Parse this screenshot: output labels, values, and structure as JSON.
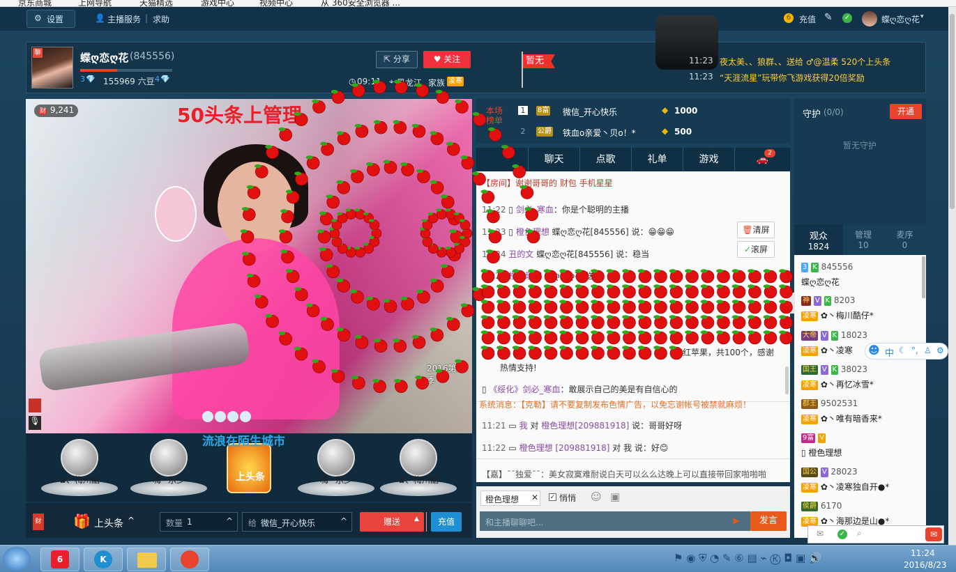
{
  "bookmarks": [
    "京东商城",
    "上网导航",
    "天猫精选",
    "游戏中心",
    "视频中心",
    "从 360安全浏览器 ..."
  ],
  "topnav": {
    "settings": "设置",
    "anchor_service": "主播服务",
    "help": "求助",
    "recharge": "充值",
    "username": "蝶ღ恋ღ花"
  },
  "anchor": {
    "name": "蝶ღ恋ღ花",
    "id": "(845556)",
    "level_left": "3",
    "beans": "155969 六豆",
    "level_right": "4",
    "share": "分享",
    "follow": "关注",
    "time": "09:11",
    "location": "黑龙江",
    "family_label": "家族",
    "family_badge": "凌寒",
    "flag": "暂无"
  },
  "notices": [
    {
      "time": "11:23",
      "text": "夜太美、、狼群、、送给 ♂@温柔 520个上头条"
    },
    {
      "time": "11:23",
      "text": "“天涯流星”玩带你飞游戏获得20倍奖励"
    }
  ],
  "video": {
    "count": "9,241",
    "overlay": "50头条上管理",
    "scroll_text": "流浪在陌生城市",
    "brand": "2016第二季"
  },
  "contributors": [
    {
      "name": "✿、梅川酷"
    },
    {
      "name": "嗨~乐少"
    },
    {
      "name": "上头条"
    },
    {
      "name": "嗨~乐少"
    },
    {
      "name": "✿、梅川酷"
    }
  ],
  "giftbar": {
    "headline": "上头条",
    "qty_label": "数量",
    "qty": "1",
    "to_label": "给",
    "to_name": "微信_开心快乐",
    "give": "赠送",
    "recharge": "充值"
  },
  "rank": {
    "title_line1": "本场",
    "title_line2": "榜单",
    "rows": [
      {
        "rank": "1",
        "badge": "8富",
        "name": "微信_开心快乐",
        "amount": "1000"
      },
      {
        "rank": "2",
        "badge": "公爵",
        "name": "铁血o亲爱丶贝o！*",
        "amount": "500"
      }
    ]
  },
  "chat_tabs": [
    "聊天",
    "点歌",
    "礼单",
    "游戏"
  ],
  "car_count": "2",
  "chat": {
    "room_line": "【房间】谢谢哥哥的 财包 手机星星",
    "lines": [
      {
        "time": "11:22",
        "nick": "剑必_寒血",
        "text": "：你是个聪明的主播"
      },
      {
        "time": "11:23",
        "nick": "橙色理想",
        "text": "蝶ღ恋ღ花[845556] 说：😁😁😁"
      },
      {
        "time": "11:24",
        "nick": "丑的文",
        "text": "蝶ღ恋ღ花[845556] 说：稳当"
      },
      {
        "time": "11:24",
        "nick": "橙色理想",
        "text": "蝶ღ恋ღ花 送"
      }
    ],
    "gift_tail": "红苹果，共100个，感谢",
    "gift_tail2": "热情支持!",
    "line_after": {
      "nick": "《绥化》剑必_寒血",
      "text": "：敢展示自己的美是有自信心的"
    },
    "system_line": "系统消息：【克勒】请不要复制发布色情广告，以免忘谢帐号被禁就麻烦！",
    "private": [
      {
        "time": "11:21",
        "me": "我",
        "to": "对",
        "nick": "橙色理想[209881918]",
        "text": "说：哥哥好呀"
      },
      {
        "time": "11:22",
        "me": "",
        "to": "",
        "nick": "橙色理想 [209881918]",
        "text": "对 我 说：好😊"
      }
    ],
    "broadcast": "【嘉】ˉˉ独爱ˉˉ：美女寂寞难耐说白天可以么么达晚上可以直接带回家啪啪啪",
    "clear": "清屏",
    "scroll": "滚屏"
  },
  "input": {
    "target": "橙色理想",
    "whisper": "悄悄",
    "placeholder": "和主播聊聊吧...",
    "send": "发言"
  },
  "guard": {
    "title": "守护",
    "count": "(0/0)",
    "open": "开通",
    "empty": "暂无守护"
  },
  "audience_tabs": [
    {
      "label": "观众",
      "count": "1824"
    },
    {
      "label": "管理",
      "count": "10"
    },
    {
      "label": "麦序",
      "count": "0"
    }
  ],
  "audience": [
    {
      "badge": "",
      "id": "845556",
      "name": "蝶ღ恋ღ花"
    },
    {
      "badge": "神",
      "id": "8203",
      "name": "✿丶梅川酷仔*"
    },
    {
      "badge": "大帝",
      "id": "18023",
      "name": "✿丶凌寒"
    },
    {
      "badge": "国王",
      "id": "38023",
      "name": "✿丶再忆冰雪*"
    },
    {
      "badge": "郡王",
      "id": "9502531",
      "name": "✿丶唯有暗香来*"
    },
    {
      "badge": "9富",
      "id": "",
      "name": "橙色理想"
    },
    {
      "badge": "国公",
      "id": "28023",
      "name": "✿丶凌寒独自开●*"
    },
    {
      "badge": "侯爵",
      "id": "6170",
      "name": "✿丶海那边是山●*"
    }
  ],
  "family_badge": "凌寒",
  "ime": "中",
  "clock": {
    "time": "11:24",
    "date": "2016/8/23"
  },
  "colors": {
    "follow": "#f0303c",
    "give": "#e8433c",
    "recharge": "#1e8fd0",
    "send": "#e85a1c",
    "apple": "#e01010",
    "leaf": "#2fa81c"
  }
}
